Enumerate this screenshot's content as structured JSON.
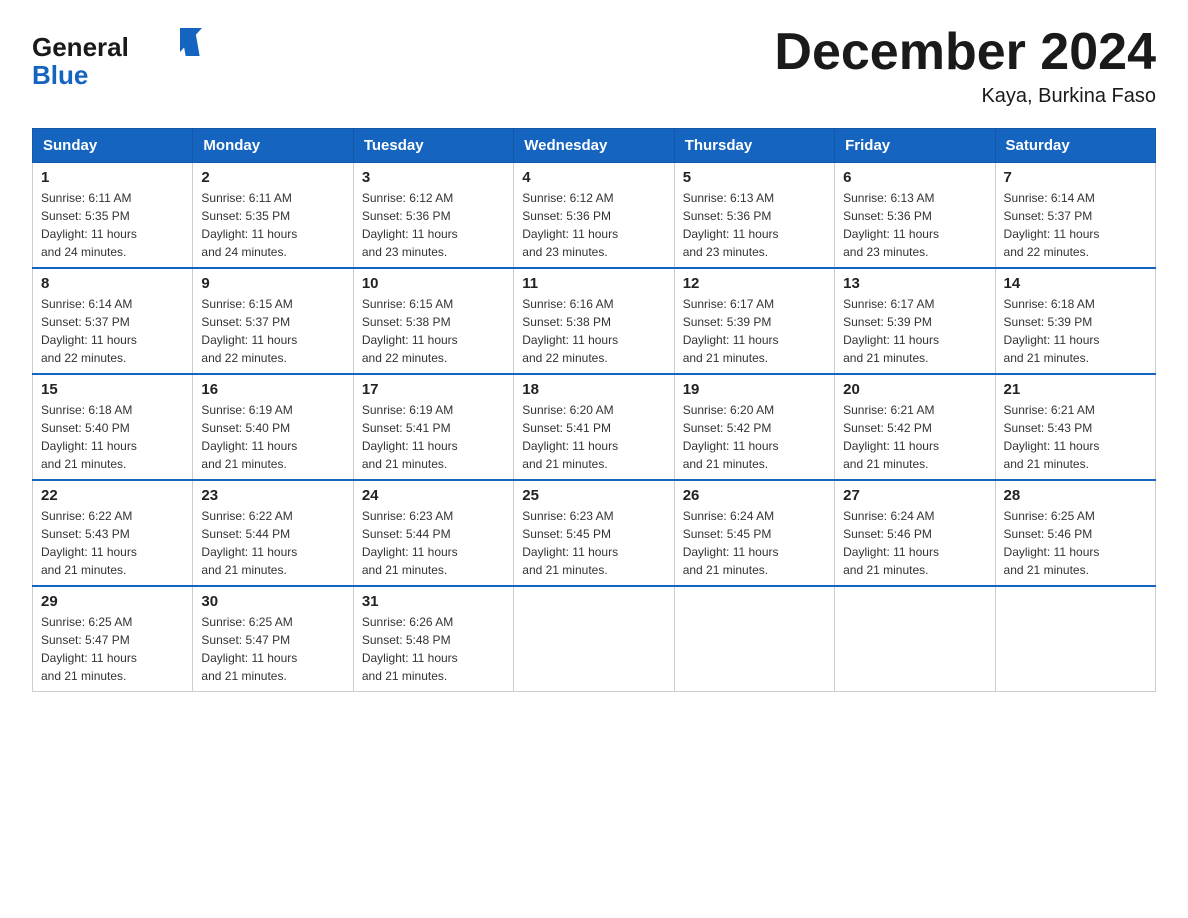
{
  "header": {
    "logo_general": "General",
    "logo_blue": "Blue",
    "month": "December 2024",
    "location": "Kaya, Burkina Faso"
  },
  "days_of_week": [
    "Sunday",
    "Monday",
    "Tuesday",
    "Wednesday",
    "Thursday",
    "Friday",
    "Saturday"
  ],
  "weeks": [
    [
      {
        "day": "1",
        "sunrise": "6:11 AM",
        "sunset": "5:35 PM",
        "daylight": "11 hours and 24 minutes."
      },
      {
        "day": "2",
        "sunrise": "6:11 AM",
        "sunset": "5:35 PM",
        "daylight": "11 hours and 24 minutes."
      },
      {
        "day": "3",
        "sunrise": "6:12 AM",
        "sunset": "5:36 PM",
        "daylight": "11 hours and 23 minutes."
      },
      {
        "day": "4",
        "sunrise": "6:12 AM",
        "sunset": "5:36 PM",
        "daylight": "11 hours and 23 minutes."
      },
      {
        "day": "5",
        "sunrise": "6:13 AM",
        "sunset": "5:36 PM",
        "daylight": "11 hours and 23 minutes."
      },
      {
        "day": "6",
        "sunrise": "6:13 AM",
        "sunset": "5:36 PM",
        "daylight": "11 hours and 23 minutes."
      },
      {
        "day": "7",
        "sunrise": "6:14 AM",
        "sunset": "5:37 PM",
        "daylight": "11 hours and 22 minutes."
      }
    ],
    [
      {
        "day": "8",
        "sunrise": "6:14 AM",
        "sunset": "5:37 PM",
        "daylight": "11 hours and 22 minutes."
      },
      {
        "day": "9",
        "sunrise": "6:15 AM",
        "sunset": "5:37 PM",
        "daylight": "11 hours and 22 minutes."
      },
      {
        "day": "10",
        "sunrise": "6:15 AM",
        "sunset": "5:38 PM",
        "daylight": "11 hours and 22 minutes."
      },
      {
        "day": "11",
        "sunrise": "6:16 AM",
        "sunset": "5:38 PM",
        "daylight": "11 hours and 22 minutes."
      },
      {
        "day": "12",
        "sunrise": "6:17 AM",
        "sunset": "5:39 PM",
        "daylight": "11 hours and 21 minutes."
      },
      {
        "day": "13",
        "sunrise": "6:17 AM",
        "sunset": "5:39 PM",
        "daylight": "11 hours and 21 minutes."
      },
      {
        "day": "14",
        "sunrise": "6:18 AM",
        "sunset": "5:39 PM",
        "daylight": "11 hours and 21 minutes."
      }
    ],
    [
      {
        "day": "15",
        "sunrise": "6:18 AM",
        "sunset": "5:40 PM",
        "daylight": "11 hours and 21 minutes."
      },
      {
        "day": "16",
        "sunrise": "6:19 AM",
        "sunset": "5:40 PM",
        "daylight": "11 hours and 21 minutes."
      },
      {
        "day": "17",
        "sunrise": "6:19 AM",
        "sunset": "5:41 PM",
        "daylight": "11 hours and 21 minutes."
      },
      {
        "day": "18",
        "sunrise": "6:20 AM",
        "sunset": "5:41 PM",
        "daylight": "11 hours and 21 minutes."
      },
      {
        "day": "19",
        "sunrise": "6:20 AM",
        "sunset": "5:42 PM",
        "daylight": "11 hours and 21 minutes."
      },
      {
        "day": "20",
        "sunrise": "6:21 AM",
        "sunset": "5:42 PM",
        "daylight": "11 hours and 21 minutes."
      },
      {
        "day": "21",
        "sunrise": "6:21 AM",
        "sunset": "5:43 PM",
        "daylight": "11 hours and 21 minutes."
      }
    ],
    [
      {
        "day": "22",
        "sunrise": "6:22 AM",
        "sunset": "5:43 PM",
        "daylight": "11 hours and 21 minutes."
      },
      {
        "day": "23",
        "sunrise": "6:22 AM",
        "sunset": "5:44 PM",
        "daylight": "11 hours and 21 minutes."
      },
      {
        "day": "24",
        "sunrise": "6:23 AM",
        "sunset": "5:44 PM",
        "daylight": "11 hours and 21 minutes."
      },
      {
        "day": "25",
        "sunrise": "6:23 AM",
        "sunset": "5:45 PM",
        "daylight": "11 hours and 21 minutes."
      },
      {
        "day": "26",
        "sunrise": "6:24 AM",
        "sunset": "5:45 PM",
        "daylight": "11 hours and 21 minutes."
      },
      {
        "day": "27",
        "sunrise": "6:24 AM",
        "sunset": "5:46 PM",
        "daylight": "11 hours and 21 minutes."
      },
      {
        "day": "28",
        "sunrise": "6:25 AM",
        "sunset": "5:46 PM",
        "daylight": "11 hours and 21 minutes."
      }
    ],
    [
      {
        "day": "29",
        "sunrise": "6:25 AM",
        "sunset": "5:47 PM",
        "daylight": "11 hours and 21 minutes."
      },
      {
        "day": "30",
        "sunrise": "6:25 AM",
        "sunset": "5:47 PM",
        "daylight": "11 hours and 21 minutes."
      },
      {
        "day": "31",
        "sunrise": "6:26 AM",
        "sunset": "5:48 PM",
        "daylight": "11 hours and 21 minutes."
      },
      null,
      null,
      null,
      null
    ]
  ],
  "labels": {
    "sunrise": "Sunrise:",
    "sunset": "Sunset:",
    "daylight": "Daylight:"
  }
}
